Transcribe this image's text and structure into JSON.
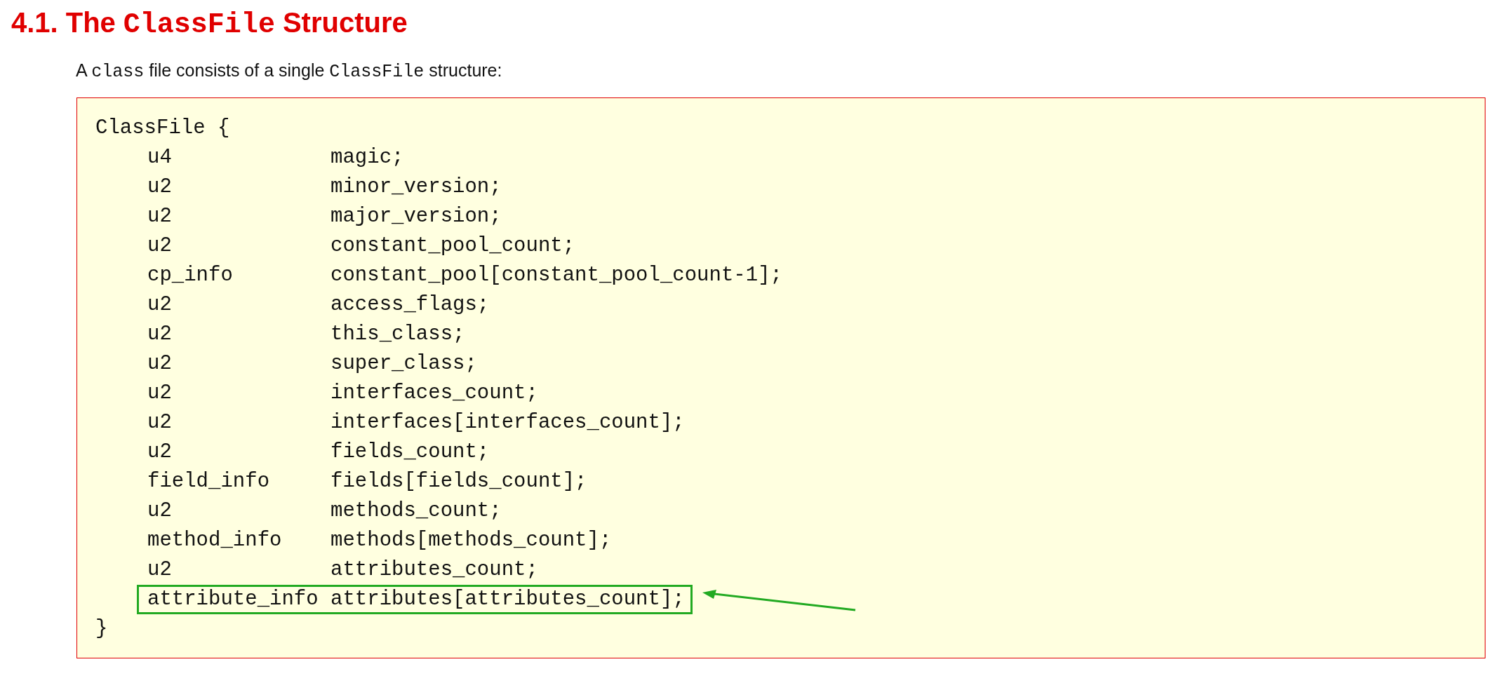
{
  "heading": {
    "number": "4.1.",
    "parts": [
      {
        "kind": "text",
        "text": "The"
      },
      {
        "kind": "code",
        "text": "ClassFile"
      },
      {
        "kind": "text",
        "text": "Structure"
      }
    ]
  },
  "intro": [
    {
      "kind": "text",
      "text": "A "
    },
    {
      "kind": "code",
      "text": "class"
    },
    {
      "kind": "text",
      "text": " file consists of a single "
    },
    {
      "kind": "code",
      "text": "ClassFile"
    },
    {
      "kind": "text",
      "text": " structure:"
    }
  ],
  "code_block": {
    "opening": "ClassFile {",
    "fields": [
      {
        "type": "u4",
        "name": "magic;",
        "highlighted": false
      },
      {
        "type": "u2",
        "name": "minor_version;",
        "highlighted": false
      },
      {
        "type": "u2",
        "name": "major_version;",
        "highlighted": false
      },
      {
        "type": "u2",
        "name": "constant_pool_count;",
        "highlighted": false
      },
      {
        "type": "cp_info",
        "name": "constant_pool[constant_pool_count-1];",
        "highlighted": false
      },
      {
        "type": "u2",
        "name": "access_flags;",
        "highlighted": false
      },
      {
        "type": "u2",
        "name": "this_class;",
        "highlighted": false
      },
      {
        "type": "u2",
        "name": "super_class;",
        "highlighted": false
      },
      {
        "type": "u2",
        "name": "interfaces_count;",
        "highlighted": false
      },
      {
        "type": "u2",
        "name": "interfaces[interfaces_count];",
        "highlighted": false
      },
      {
        "type": "u2",
        "name": "fields_count;",
        "highlighted": false
      },
      {
        "type": "field_info",
        "name": "fields[fields_count];",
        "highlighted": false
      },
      {
        "type": "u2",
        "name": "methods_count;",
        "highlighted": false
      },
      {
        "type": "method_info",
        "name": "methods[methods_count];",
        "highlighted": false
      },
      {
        "type": "u2",
        "name": "attributes_count;",
        "highlighted": false
      },
      {
        "type": "attribute_info",
        "name": "attributes[attributes_count];",
        "highlighted": true
      }
    ],
    "closing": "}"
  }
}
